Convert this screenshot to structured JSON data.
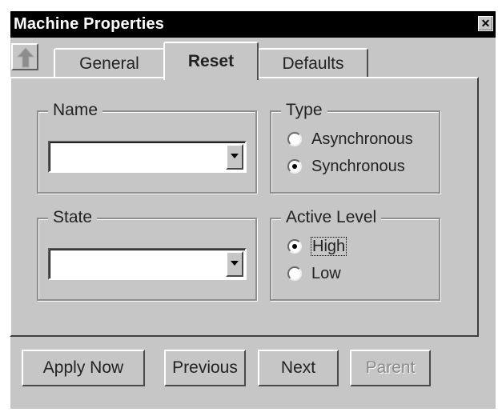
{
  "window": {
    "title": "Machine Properties",
    "close_glyph": "✕"
  },
  "tabs": [
    {
      "label": "General",
      "active": false
    },
    {
      "label": "Reset",
      "active": true
    },
    {
      "label": "Defaults",
      "active": false
    }
  ],
  "up_button_icon": "up-arrow-icon",
  "name_group": {
    "legend": "Name",
    "value": ""
  },
  "state_group": {
    "legend": "State",
    "value": ""
  },
  "type_group": {
    "legend": "Type",
    "options": [
      {
        "label": "Asynchronous",
        "selected": false
      },
      {
        "label": "Synchronous",
        "selected": true
      }
    ]
  },
  "active_level_group": {
    "legend": "Active Level",
    "options": [
      {
        "label": "High",
        "selected": true
      },
      {
        "label": "Low",
        "selected": false
      }
    ]
  },
  "buttons": {
    "apply": "Apply Now",
    "previous": "Previous",
    "next": "Next",
    "parent": "Parent",
    "parent_disabled": true
  }
}
